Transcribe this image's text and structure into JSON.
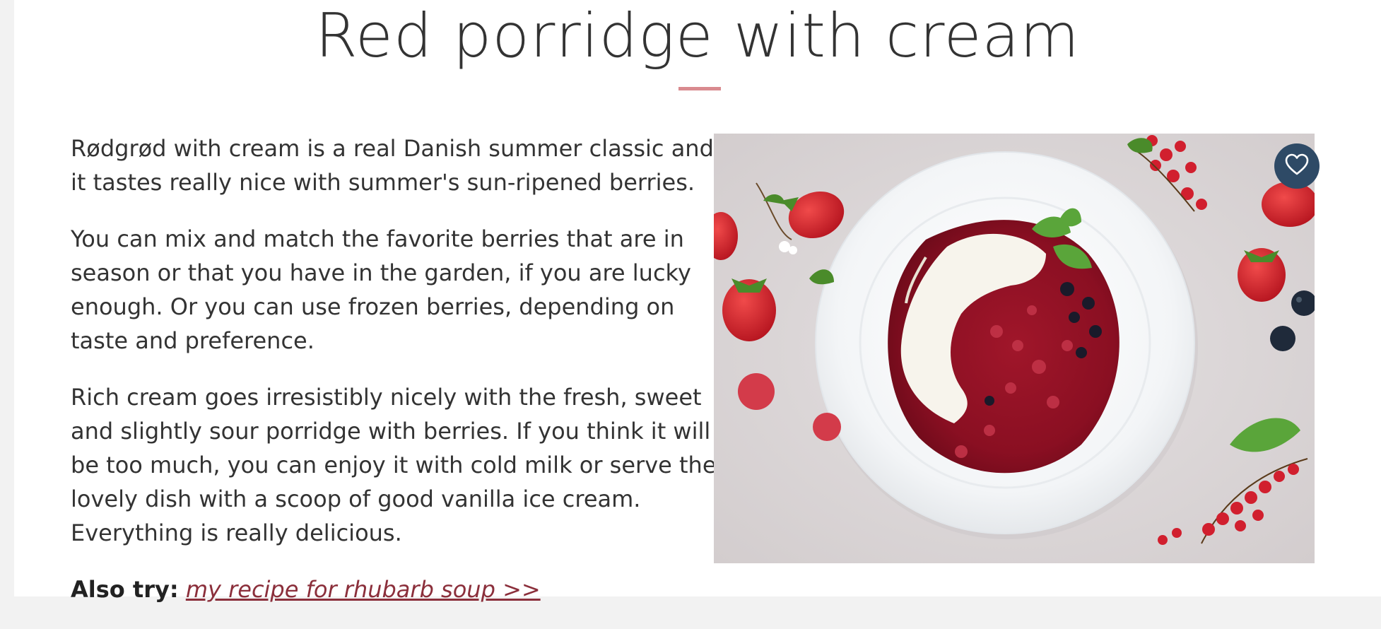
{
  "article": {
    "title": "Red porridge with cream",
    "paragraphs": [
      "Rødgrød with cream is a real Danish summer classic and it tastes really nice with summer's sun-ripened berries.",
      "You can mix and match the favorite berries that are in season or that you have in the garden, if you are lucky enough. Or you can use frozen berries, depending on taste and preference.",
      "Rich cream goes irresistibly nicely with the fresh, sweet and slightly sour porridge with berries. If you think it will be too much, you can enjoy it with cold milk or serve the lovely dish with a scoop of good vanilla ice cream. Everything is really delicious."
    ],
    "also_try_label": "Also try:",
    "also_try_link": "my recipe for rhubarb soup >>"
  },
  "photo": {
    "alt": "red porridge with cream and berries"
  },
  "favorite": {
    "icon": "heart-icon"
  },
  "colors": {
    "accent_rule": "#d98a8f",
    "link": "#8b2f3b",
    "favorite_bg": "#2e4a66"
  }
}
